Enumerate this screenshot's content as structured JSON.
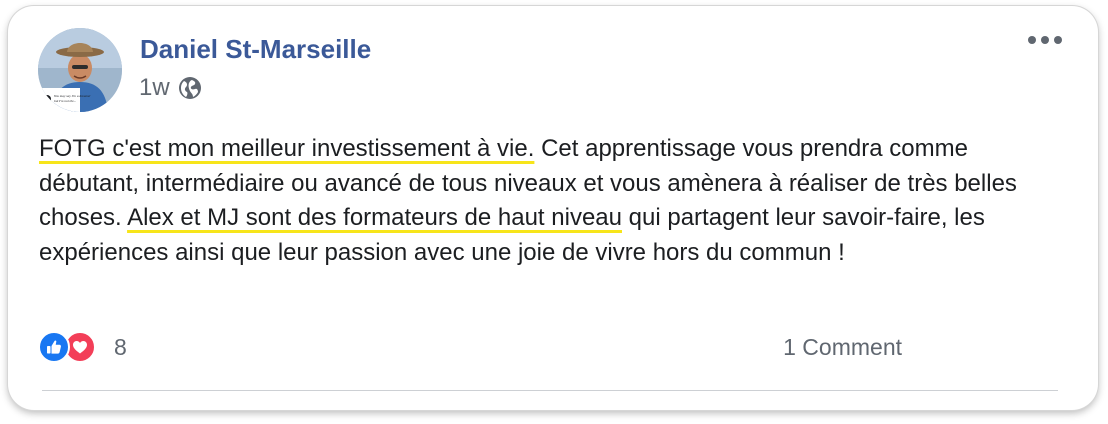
{
  "post": {
    "author": "Daniel St-Marseille",
    "time": "1w",
    "privacy_icon": "globe-icon",
    "avatar_caption_line1": "You may say I'm a dreamer",
    "avatar_caption_line2": "but I'm not the...",
    "body": {
      "highlight1": "FOTG c'est mon meilleur investissement à vie.",
      "text1": " Cet apprentissage vous prendra comme débutant, intermédiaire ou avancé de tous niveaux et vous amènera à réaliser de très belles choses. ",
      "highlight2": "Alex et MJ sont des formateurs de haut niveau",
      "text2": " qui partagent leur savoir-faire, les expériences ainsi que leur passion avec une joie de vivre hors du commun !"
    },
    "highlight_color": "#f7e51a"
  },
  "footer": {
    "reaction_icons": [
      "like-icon",
      "love-icon"
    ],
    "reaction_count": "8",
    "comments": "1 Comment"
  },
  "colors": {
    "author": "#3b5998",
    "like": "#1877f2",
    "love": "#f33e58",
    "meta": "#606770"
  }
}
